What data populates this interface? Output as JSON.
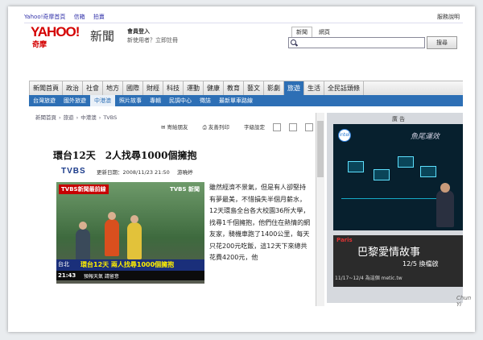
{
  "topbar": {
    "links": [
      "Yahoo!奇摩首頁",
      "信箱",
      "拍賣"
    ],
    "help": "服務說明"
  },
  "brand": {
    "logo": "YAHOO!",
    "logo_sub": "奇摩",
    "section": "新聞"
  },
  "member": {
    "login": "會員登入",
    "register": "新使用者？立即註冊"
  },
  "search": {
    "tabs": [
      "新聞",
      "網頁"
    ],
    "button": "搜尋",
    "placeholder": ""
  },
  "nav_primary": [
    "新聞首頁",
    "政治",
    "社會",
    "地方",
    "國際",
    "財經",
    "科技",
    "運動",
    "健康",
    "教育",
    "藝文",
    "影劇",
    "旅遊",
    "生活",
    "全民話頭條"
  ],
  "nav_primary_active": "旅遊",
  "nav_secondary": [
    "台灣旅遊",
    "國外旅遊",
    "中港澳",
    "照片故事",
    "專輯",
    "民調中心",
    "徵誌",
    "最新單車路線"
  ],
  "nav_secondary_active": "中港澳",
  "breadcrumb": [
    "新聞首頁",
    "›",
    "旅遊",
    "›",
    "中港澳",
    "›",
    "TVBS"
  ],
  "tools": {
    "mail": "寄給朋友",
    "print": "友善列印",
    "fontsize": "字級設定"
  },
  "ad": {
    "label": "廣 告",
    "intel": "intel",
    "title": "魚尾運效",
    "promo_brand": "Paris",
    "promo_title": "巴黎愛情故事",
    "promo_date": "12/5 換檔啟",
    "promo_foot": "11/17~12/4 為這個 metic.tw"
  },
  "article": {
    "title": "環台12天　2人找尋1000個擁抱",
    "source": "TVBS",
    "updated": "更新日期：2008/11/23 21:50",
    "reporter": "游曉婷",
    "body": "雖然經濟不景氣，但是有人卻堅持有夢最美，不惜損失半個月薪水，12天環島全台各大校園36所大學，找尋1千個擁抱，他們住在熱情的網友家，騎機車跑了1400公里，每天只花200元吃飯，這12天下來總共花費4200元，他"
  },
  "video": {
    "badge": "TVBS新聞最前線",
    "logo": "TVBS 新聞",
    "place": "台北",
    "caption": "環台12天 兩人找尋1000個擁抱",
    "time": "21:43",
    "ticker": "預報天氣 請留意"
  },
  "watermark": "Chun Yi"
}
